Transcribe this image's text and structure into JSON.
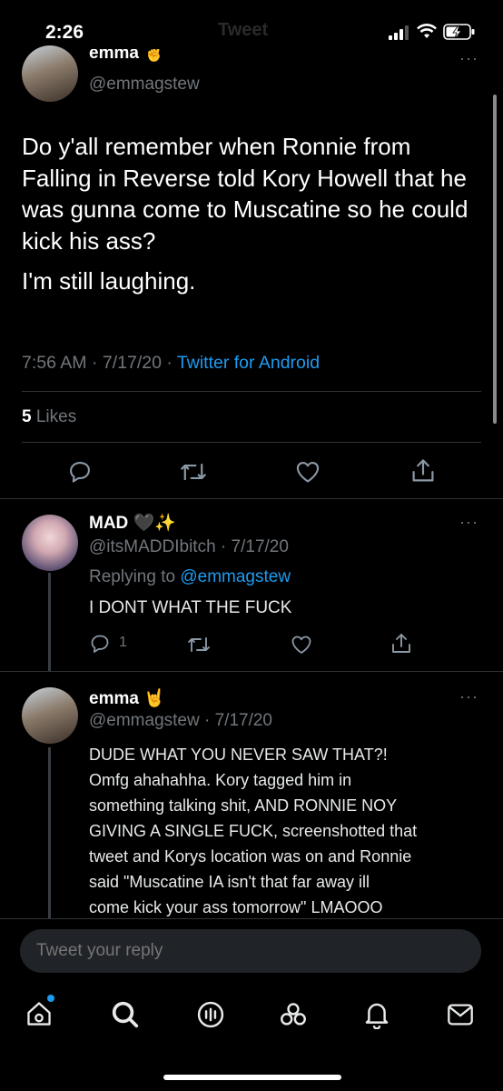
{
  "status_bar": {
    "time": "2:26",
    "faded_title": "Tweet"
  },
  "main_tweet": {
    "display_name": "emma",
    "name_emoji": "✌️",
    "handle": "@emmagstew",
    "text_p1": "Do y'all remember when Ronnie from Falling in Reverse told Kory Howell that he was gunna come to Muscatine so he could kick his ass?",
    "text_p2": "I'm still laughing.",
    "time_date": "7:56 AM · 7/17/20 · ",
    "source": "Twitter for Android",
    "likes_count": "5",
    "likes_label": "Likes"
  },
  "reply1": {
    "display_name": "MAD",
    "name_emoji": "🖤✨",
    "handle_date": "@itsMADDIbitch · 7/17/20",
    "replying_label": "Replying to ",
    "replying_handle": "@emmagstew",
    "text": "I DONT WHAT THE FUCK",
    "reply_count": "1"
  },
  "reply2": {
    "display_name": "emma",
    "name_emoji": "🤘",
    "handle_date": "@emmagstew · 7/17/20",
    "text": "DUDE WHAT YOU NEVER SAW THAT?!\nOmfg ahahahha. Kory tagged him in\nsomething talking shit, AND RONNIE NOY\nGIVING A SINGLE FUCK, screenshotted that\ntweet and Korys location was on and Ronnie\nsaid \"Muscatine IA isn't that far away ill\ncome kick your ass tomorrow\" LMAOOO"
  },
  "compose": {
    "placeholder": "Tweet your reply"
  },
  "tabs": [
    "home-icon",
    "search-icon",
    "spaces-icon",
    "communities-icon",
    "notifications-icon",
    "messages-icon"
  ],
  "colors": {
    "accent": "#1d9bf0",
    "background": "#000000",
    "text": "#e7e9ea",
    "muted": "#71767b"
  }
}
